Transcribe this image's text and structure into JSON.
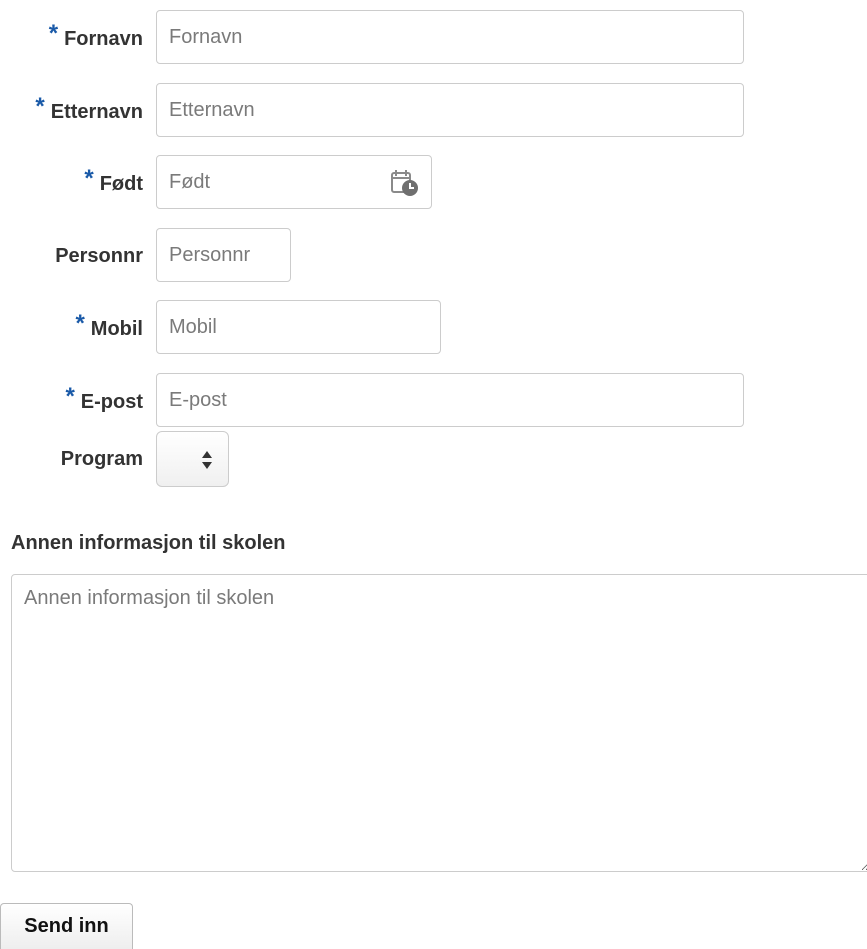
{
  "required_marker": "*",
  "fields": {
    "fornavn": {
      "label": "Fornavn",
      "placeholder": "Fornavn"
    },
    "etternavn": {
      "label": "Etternavn",
      "placeholder": "Etternavn"
    },
    "fodt": {
      "label": "Født",
      "placeholder": "Født"
    },
    "personnr": {
      "label": "Personnr",
      "placeholder": "Personnr"
    },
    "mobil": {
      "label": "Mobil",
      "placeholder": "Mobil"
    },
    "epost": {
      "label": "E-post",
      "placeholder": "E-post"
    },
    "program": {
      "label": "Program",
      "selected": ""
    }
  },
  "other_info": {
    "heading": "Annen informasjon til skolen",
    "placeholder": "Annen informasjon til skolen"
  },
  "submit_label": "Send inn",
  "colors": {
    "required_marker": "#1a5aa8",
    "border": "#cccccc",
    "label_text": "#333333"
  },
  "icons": {
    "date_picker": "calendar-clock-icon",
    "select_arrows": "select-arrows-icon"
  }
}
